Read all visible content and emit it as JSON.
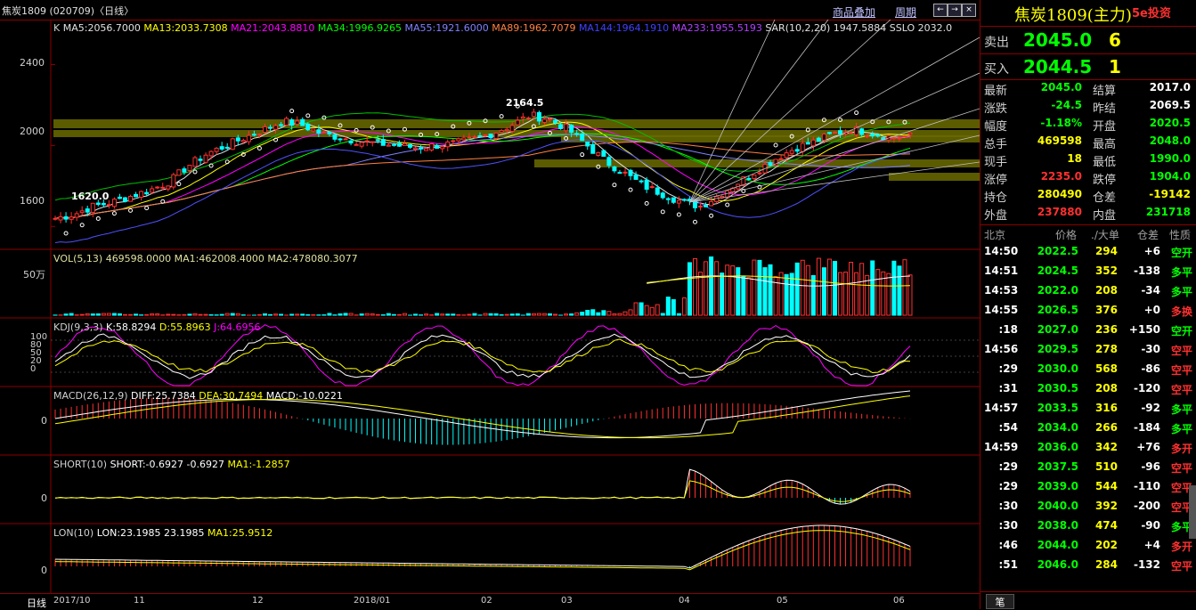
{
  "title_bar": {
    "symbol": "焦炭1809 (020709)〈日线〉",
    "link_overlay": "商品叠加",
    "link_period": "周期",
    "btn_prev": "←",
    "btn_next": "→",
    "btn_restore": "◻",
    "btn_close": "×"
  },
  "main_panel": {
    "legend": [
      {
        "text": "K",
        "color": "#d0d0d0"
      },
      {
        "text": "MA5:2056.7000",
        "color": "#e0e0e0"
      },
      {
        "text": "MA13:2033.7308",
        "color": "#ffff00"
      },
      {
        "text": "MA21:2043.8810",
        "color": "#ff00ff"
      },
      {
        "text": "MA34:1996.9265",
        "color": "#00ff00"
      },
      {
        "text": "MA55:1921.6000",
        "color": "#8080ff"
      },
      {
        "text": "MA89:1962.7079",
        "color": "#ff8040"
      },
      {
        "text": "MA144:1964.1910",
        "color": "#4040ff"
      },
      {
        "text": "MA233:1955.5193",
        "color": "#b040ff"
      },
      {
        "text": "SAR(10,2,20)  1947.5884",
        "color": "#e0e0e0"
      },
      {
        "text": "SSLO  2032.0",
        "color": "#e0e0e0"
      }
    ],
    "y_labels": [
      "2400",
      "2000",
      "1600"
    ],
    "annotation_high": "2164.5",
    "annotation_low": "1620.0"
  },
  "chart_data": [
    {
      "type": "candlestick",
      "title": "焦炭1809 日线",
      "ylim": [
        1500,
        2600
      ],
      "y_ticks": [
        1600,
        2000,
        2400
      ],
      "x_ticks": [
        "2017/10",
        "11",
        "12",
        "2018/01",
        "02",
        "03",
        "04",
        "05",
        "06"
      ],
      "close_approx": [
        1640,
        1660,
        1700,
        1720,
        1750,
        1780,
        1820,
        1900,
        1960,
        2000,
        2040,
        2080,
        2120,
        2100,
        2060,
        2040,
        2020,
        2010,
        2000,
        1990,
        2000,
        2010,
        2030,
        2060,
        2100,
        2150,
        2130,
        2080,
        2000,
        1920,
        1860,
        1800,
        1760,
        1720,
        1700,
        1760,
        1820,
        1880,
        1940,
        1990,
        2020,
        2060,
        2080,
        2060,
        2040,
        2045
      ],
      "high_label": 2164.5,
      "low_label": 1620.0
    },
    {
      "type": "bar",
      "title": "VOL(5,13)",
      "legend": [
        "VOL(5,13) 469598.0000",
        "MA1:462008.4000",
        "MA2:478080.3077"
      ],
      "y_label": "50万"
    },
    {
      "type": "line",
      "title": "KDJ(9,3,3)",
      "legend": [
        "K:58.8294",
        "D:55.8963",
        "J:64.6956"
      ],
      "y_ticks": [
        0,
        20,
        50,
        80,
        100
      ]
    },
    {
      "type": "bar",
      "title": "MACD(26,12,9)",
      "legend": [
        "DIFF:25.7384",
        "DEA:30.7494",
        "MACD:-10.0221"
      ],
      "y_ticks": [
        0
      ]
    },
    {
      "type": "line",
      "title": "SHORT(10)",
      "legend": [
        "SHORT:-0.6927",
        "-0.6927",
        "MA1:-1.2857"
      ],
      "y_ticks": [
        0
      ]
    },
    {
      "type": "bar",
      "title": "LON(10)",
      "legend": [
        "LON:23.1985",
        "23.1985",
        "MA1:25.9512"
      ],
      "y_ticks": [
        0
      ]
    }
  ],
  "vol_panel": {
    "legend": "VOL(5,13)  469598.0000  MA1:462008.4000  MA2:478080.3077",
    "y_label": "50万"
  },
  "kdj_panel": {
    "legend_name": "KDJ(9,3,3)",
    "k": "K:58.8294",
    "d": "D:55.8963",
    "j": "J:64.6956",
    "y_labels": [
      "100",
      "80",
      "50",
      "20",
      "0"
    ]
  },
  "macd_panel": {
    "legend_name": "MACD(26,12,9)",
    "diff": "DIFF:25.7384",
    "dea": "DEA:30.7494",
    "macd": "MACD:-10.0221",
    "y_label": "0"
  },
  "short_panel": {
    "legend_name": "SHORT(10)",
    "short": "SHORT:-0.6927",
    "val": "-0.6927",
    "ma1": "MA1:-1.2857",
    "y_label": "0"
  },
  "lon_panel": {
    "legend_name": "LON(10)",
    "lon": "LON:23.1985",
    "val": "23.1985",
    "ma1": "MA1:25.9512",
    "y_label": "0"
  },
  "bottom_bar": {
    "period": "日线",
    "x_labels": [
      "2017/10",
      "11",
      "12",
      "2018/01",
      "02",
      "03",
      "04",
      "05",
      "06"
    ]
  },
  "quote_panel": {
    "title": "焦炭1809(主力)",
    "watermark": "5e投资 5etz.com",
    "ask_label": "卖出",
    "ask_price": "2045.0",
    "ask_vol": "6",
    "bid_label": "买入",
    "bid_price": "2044.5",
    "bid_vol": "1",
    "stats": [
      {
        "k1": "最新",
        "v1": "2045.0",
        "c1": "#00ff00",
        "k2": "结算",
        "v2": "2017.0",
        "c2": "#ffffff"
      },
      {
        "k1": "涨跌",
        "v1": "-24.5",
        "c1": "#00ff00",
        "k2": "昨结",
        "v2": "2069.5",
        "c2": "#ffffff"
      },
      {
        "k1": "幅度",
        "v1": "-1.18%",
        "c1": "#00ff00",
        "k2": "开盘",
        "v2": "2020.5",
        "c2": "#00ff00"
      },
      {
        "k1": "总手",
        "v1": "469598",
        "c1": "#ffff00",
        "k2": "最高",
        "v2": "2048.0",
        "c2": "#00ff00"
      },
      {
        "k1": "现手",
        "v1": "18",
        "c1": "#ffff00",
        "k2": "最低",
        "v2": "1990.0",
        "c2": "#00ff00"
      },
      {
        "k1": "涨停",
        "v1": "2235.0",
        "c1": "#ff3030",
        "k2": "跌停",
        "v2": "1904.0",
        "c2": "#00ff00"
      },
      {
        "k1": "持仓",
        "v1": "280490",
        "c1": "#ffff00",
        "k2": "仓差",
        "v2": "-19142",
        "c2": "#ffff00"
      },
      {
        "k1": "外盘",
        "v1": "237880",
        "c1": "#ff3030",
        "k2": "内盘",
        "v2": "231718",
        "c2": "#00ff00"
      }
    ],
    "tick_headers": [
      "北京",
      "价格",
      "./大单",
      "仓差",
      "性质"
    ],
    "ticks": [
      {
        "time": "14:50",
        "price": "2022.5",
        "vol": "294",
        "oi": "+6",
        "nature": "空开",
        "nc": "#00ff00"
      },
      {
        "time": "14:51",
        "price": "2024.5",
        "vol": "352",
        "oi": "-138",
        "nature": "多平",
        "nc": "#00ff00"
      },
      {
        "time": "14:53",
        "price": "2022.0",
        "vol": "208",
        "oi": "-34",
        "nature": "多平",
        "nc": "#00ff00"
      },
      {
        "time": "14:55",
        "price": "2026.5",
        "vol": "376",
        "oi": "+0",
        "nature": "多换",
        "nc": "#ff3030"
      },
      {
        "time": ":18",
        "price": "2027.0",
        "vol": "236",
        "oi": "+150",
        "nature": "空开",
        "nc": "#00ff00"
      },
      {
        "time": "14:56",
        "price": "2029.5",
        "vol": "278",
        "oi": "-30",
        "nature": "空平",
        "nc": "#ff3030"
      },
      {
        "time": ":29",
        "price": "2030.0",
        "vol": "568",
        "oi": "-86",
        "nature": "空平",
        "nc": "#ff3030"
      },
      {
        "time": ":31",
        "price": "2030.5",
        "vol": "208",
        "oi": "-120",
        "nature": "空平",
        "nc": "#ff3030"
      },
      {
        "time": "14:57",
        "price": "2033.5",
        "vol": "316",
        "oi": "-92",
        "nature": "多平",
        "nc": "#00ff00"
      },
      {
        "time": ":54",
        "price": "2034.0",
        "vol": "266",
        "oi": "-184",
        "nature": "多平",
        "nc": "#00ff00"
      },
      {
        "time": "14:59",
        "price": "2036.0",
        "vol": "342",
        "oi": "+76",
        "nature": "多开",
        "nc": "#ff3030"
      },
      {
        "time": ":29",
        "price": "2037.5",
        "vol": "510",
        "oi": "-96",
        "nature": "空平",
        "nc": "#ff3030"
      },
      {
        "time": ":29",
        "price": "2039.0",
        "vol": "544",
        "oi": "-110",
        "nature": "空平",
        "nc": "#ff3030"
      },
      {
        "time": ":30",
        "price": "2040.0",
        "vol": "392",
        "oi": "-200",
        "nature": "空平",
        "nc": "#ff3030"
      },
      {
        "time": ":30",
        "price": "2038.0",
        "vol": "474",
        "oi": "-90",
        "nature": "多平",
        "nc": "#00ff00"
      },
      {
        "time": ":46",
        "price": "2044.0",
        "vol": "202",
        "oi": "+4",
        "nature": "多开",
        "nc": "#ff3030"
      },
      {
        "time": ":51",
        "price": "2046.0",
        "vol": "284",
        "oi": "-132",
        "nature": "空平",
        "nc": "#ff3030"
      }
    ],
    "bottom_tab": "笔"
  }
}
